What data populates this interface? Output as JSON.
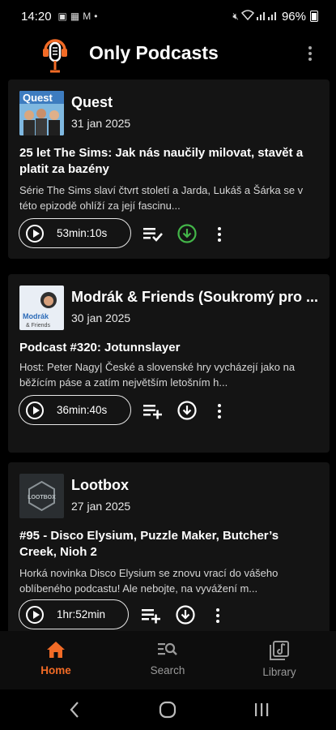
{
  "status_bar": {
    "time": "14:20",
    "battery": "96%"
  },
  "app": {
    "title": "Only Podcasts",
    "accent_color": "#f26b26"
  },
  "episodes": [
    {
      "podcast": "Quest",
      "date": "31 jan 2025",
      "title": "25 let The Sims: Jak nás naučily milovat, stavět a platit za bazény",
      "description": "Série The Sims slaví čtvrt století a Jarda, Lukáš a Šárka se v této epizodě ohlíží za její fascinu...",
      "duration": "53min:10s",
      "thumb_label": "Quest",
      "queued": true,
      "downloaded": true
    },
    {
      "podcast": "Modrák & Friends (Soukromý pro ...",
      "date": "30 jan 2025",
      "title": "Podcast #320: Jotunnslayer",
      "description": "Host: Peter Nagy| České a slovenské hry vycházejí jako na běžícím páse a zatím největším letošním h...",
      "duration": "36min:40s",
      "thumb_label": "Modrák & Friends",
      "queued": false,
      "downloaded": false
    },
    {
      "podcast": "Lootbox",
      "date": "27 jan 2025",
      "title": "#95 - Disco Elysium, Puzzle Maker, Butcher’s Creek, Nioh 2",
      "description": "Horká novinka Disco Elysium se znovu vrací do vášeho oblíbeného podcastu! Ale nebojte, na vyvážení m...",
      "duration": "1hr:52min",
      "thumb_label": "LOOTBOX",
      "queued": false,
      "downloaded": false
    }
  ],
  "bottom_nav": {
    "home": "Home",
    "search": "Search",
    "library": "Library"
  }
}
